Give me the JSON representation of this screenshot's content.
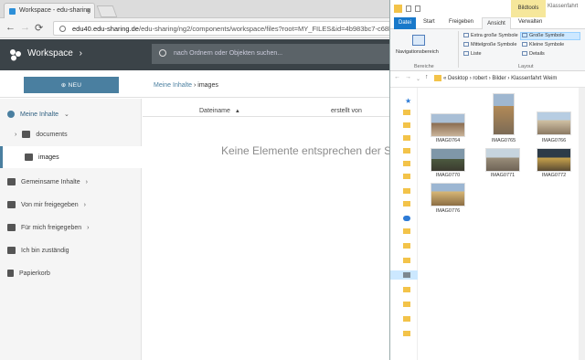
{
  "browser": {
    "tab_title": "Workspace - edu-sharing",
    "tab_close": "×",
    "url_host": "edu40.edu-sharing.de",
    "url_path": "/edu-sharing/ng2/components/workspace/files?root=MY_FILES&id=4b983bc7-c68b-4cf6-836"
  },
  "workspace": {
    "title": "Workspace",
    "search_placeholder": "nach Ordnern oder Objekten suchen...",
    "new_button": "NEU",
    "breadcrumb_root": "Meine Inhalte",
    "breadcrumb_current": "images",
    "sidebar": {
      "my_content": "Meine Inhalte",
      "folders": [
        "documents",
        "images"
      ],
      "items": [
        "Gemeinsame Inhalte",
        "Von mir freigegeben",
        "Für mich freigegeben",
        "Ich bin zuständig",
        "Papierkorb"
      ]
    },
    "table": {
      "col_name": "Dateiname",
      "col_created": "erstellt von"
    },
    "empty_message": "Keine Elemente entsprechen der Su"
  },
  "explorer": {
    "context_tab": "Bildtools",
    "window_title": "Klassenfahrt",
    "ribbon_tabs": [
      "Datei",
      "Start",
      "Freigeben",
      "Ansicht",
      "Verwalten"
    ],
    "nav_pane": "Navigationsbereich",
    "group_panes": "Bereiche",
    "group_layout": "Layout",
    "layout_options": [
      "Extra große Symbole",
      "Mittelgroße Symbole",
      "Liste",
      "Große Symbole",
      "Kleine Symbole",
      "Details"
    ],
    "path": [
      "«",
      "Desktop",
      "robert",
      "Bilder",
      "Klassenfahrt Weim"
    ],
    "files": [
      "IMAG0764",
      "IMAG0765",
      "IMAG0766",
      "IMAG0770",
      "IMAG0771",
      "IMAG0772",
      "IMAG0776"
    ]
  },
  "colors": {
    "header": "#3b4348",
    "accent": "#4a7fa0",
    "ribbon_blue": "#1979ca",
    "bildtools": "#f6e79b"
  }
}
